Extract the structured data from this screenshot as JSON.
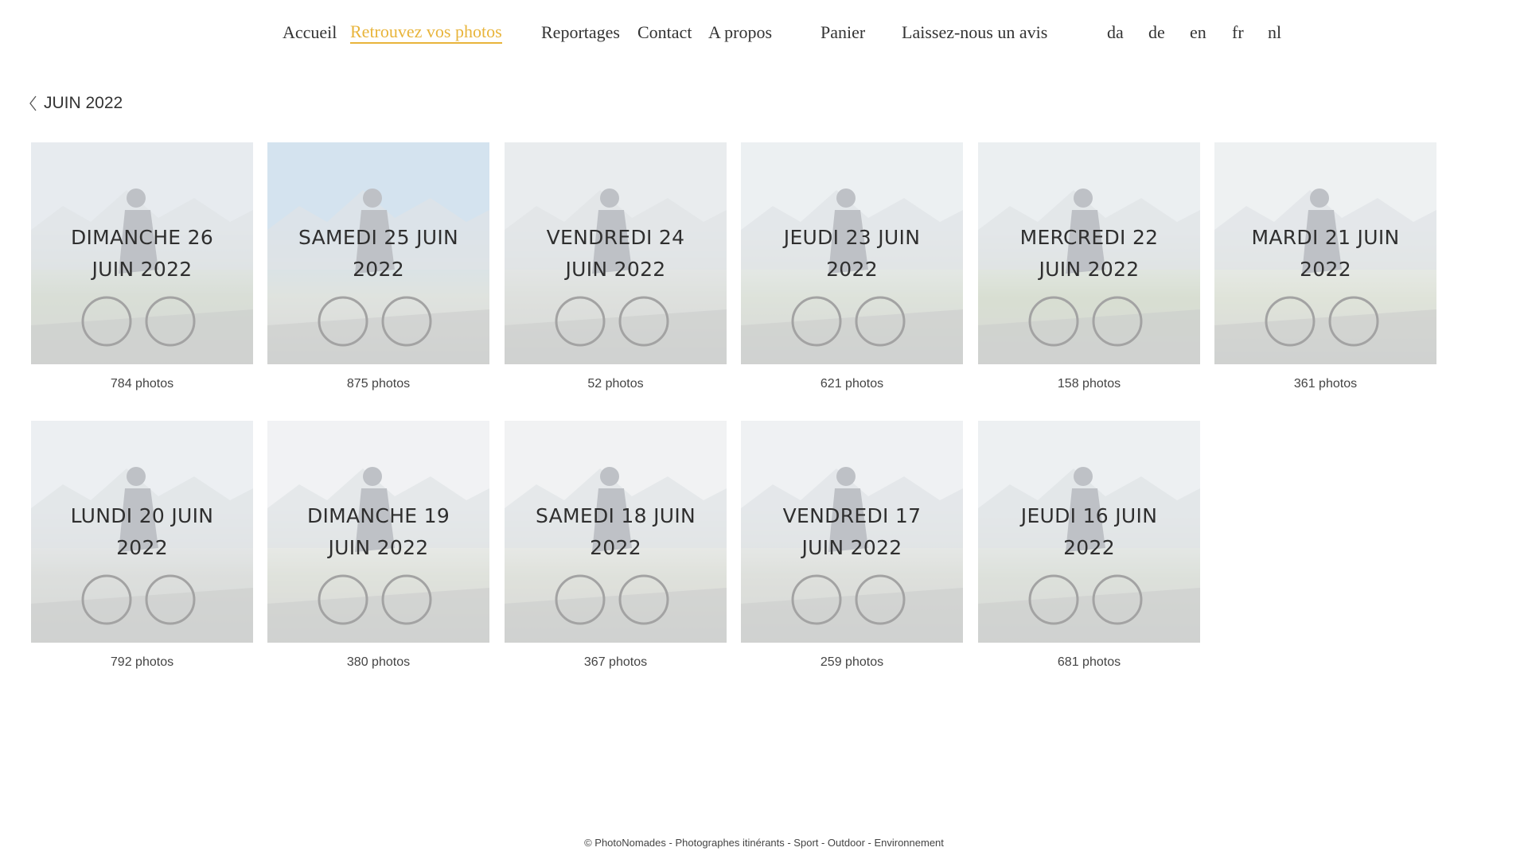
{
  "nav": {
    "items": [
      {
        "label": "Accueil"
      },
      {
        "label": "Retrouvez vos photos",
        "active": true
      },
      {
        "label": "Reportages"
      },
      {
        "label": "Contact"
      },
      {
        "label": "A propos"
      },
      {
        "label": "Panier"
      },
      {
        "label": "Laissez-nous un avis"
      }
    ],
    "languages": [
      "da",
      "de",
      "en",
      "fr",
      "nl"
    ],
    "active_color": "#e8b43a"
  },
  "breadcrumb": {
    "label": "JUIN 2022",
    "icon": "chevron-left-icon"
  },
  "albums": [
    {
      "title": "DIMANCHE 26 JUIN 2022",
      "count": "784 photos"
    },
    {
      "title": "SAMEDI 25 JUIN 2022",
      "count": "875 photos"
    },
    {
      "title": "VENDREDI 24 JUIN 2022",
      "count": "52 photos"
    },
    {
      "title": "JEUDI 23 JUIN 2022",
      "count": "621 photos"
    },
    {
      "title": "MERCREDI 22 JUIN 2022",
      "count": "158 photos"
    },
    {
      "title": "MARDI 21 JUIN 2022",
      "count": "361 photos"
    },
    {
      "title": "LUNDI 20 JUIN 2022",
      "count": "792 photos"
    },
    {
      "title": "DIMANCHE 19 JUIN 2022",
      "count": "380 photos"
    },
    {
      "title": "SAMEDI 18 JUIN 2022",
      "count": "367 photos"
    },
    {
      "title": "VENDREDI 17 JUIN 2022",
      "count": "259 photos"
    },
    {
      "title": "JEUDI 16 JUIN 2022",
      "count": "681 photos"
    }
  ],
  "footer": "© PhotoNomades - Photographes itinérants - Sport - Outdoor - Environnement"
}
